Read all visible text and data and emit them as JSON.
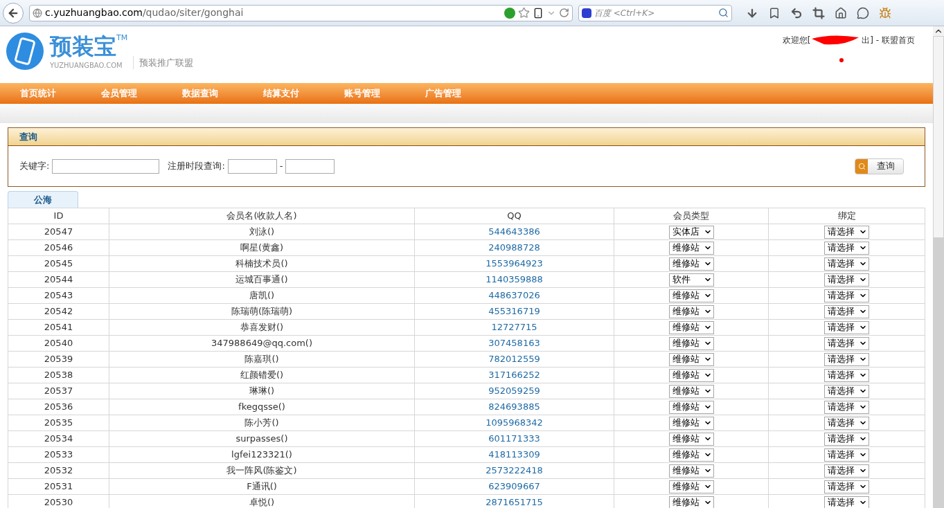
{
  "browser": {
    "url_host": "c.yuzhuangbao.com",
    "url_path": "/qudao/siter/gonghai",
    "search_placeholder": "百度 <Ctrl+K>"
  },
  "header": {
    "logo_name": "预装宝",
    "logo_tm": "TM",
    "logo_domain": "YUZHUANGBAO.COM",
    "subtitle": "预装推广联盟",
    "welcome_start": "欢迎您[",
    "welcome_end": "出] - 联盟首页"
  },
  "nav": [
    "首页统计",
    "会员管理",
    "数据查询",
    "结算支付",
    "账号管理",
    "广告管理"
  ],
  "query": {
    "title": "查询",
    "keyword_label": "关键字:",
    "period_label": "注册时段查询:",
    "separator": "-",
    "button": "查询"
  },
  "tabs": [
    {
      "label": "公海",
      "selected": true
    }
  ],
  "table": {
    "columns": [
      "ID",
      "会员名(收款人名)",
      "QQ",
      "会员类型",
      "绑定"
    ],
    "rows": [
      {
        "id": "20547",
        "name": "刘泳()",
        "qq": "544643386",
        "type": "实体店",
        "bind": "请选择"
      },
      {
        "id": "20546",
        "name": "啊星(黄鑫)",
        "qq": "240988728",
        "type": "维修站",
        "bind": "请选择"
      },
      {
        "id": "20545",
        "name": "科楠技术员()",
        "qq": "1553964923",
        "type": "维修站",
        "bind": "请选择"
      },
      {
        "id": "20544",
        "name": "运城百事通()",
        "qq": "1140359888",
        "type": "软件",
        "bind": "请选择"
      },
      {
        "id": "20543",
        "name": "唐凯()",
        "qq": "448637026",
        "type": "维修站",
        "bind": "请选择"
      },
      {
        "id": "20542",
        "name": "陈瑞萌(陈瑞萌)",
        "qq": "455316719",
        "type": "维修站",
        "bind": "请选择"
      },
      {
        "id": "20541",
        "name": "恭喜发财()",
        "qq": "12727715",
        "type": "维修站",
        "bind": "请选择"
      },
      {
        "id": "20540",
        "name": "347988649@qq.com()",
        "qq": "307458163",
        "type": "维修站",
        "bind": "请选择"
      },
      {
        "id": "20539",
        "name": "陈嘉琪()",
        "qq": "782012559",
        "type": "维修站",
        "bind": "请选择"
      },
      {
        "id": "20538",
        "name": "红颜错爱()",
        "qq": "317166252",
        "type": "维修站",
        "bind": "请选择"
      },
      {
        "id": "20537",
        "name": "琳琳()",
        "qq": "952059259",
        "type": "维修站",
        "bind": "请选择"
      },
      {
        "id": "20536",
        "name": "fkegqsse()",
        "qq": "824693885",
        "type": "维修站",
        "bind": "请选择"
      },
      {
        "id": "20535",
        "name": "陈小芳()",
        "qq": "1095968342",
        "type": "维修站",
        "bind": "请选择"
      },
      {
        "id": "20534",
        "name": "surpasses()",
        "qq": "601171333",
        "type": "维修站",
        "bind": "请选择"
      },
      {
        "id": "20533",
        "name": "lgfei123321()",
        "qq": "418113309",
        "type": "维修站",
        "bind": "请选择"
      },
      {
        "id": "20532",
        "name": "我一阵风(陈鉴文)",
        "qq": "2573222418",
        "type": "维修站",
        "bind": "请选择"
      },
      {
        "id": "20531",
        "name": "F通讯()",
        "qq": "623909667",
        "type": "维修站",
        "bind": "请选择"
      },
      {
        "id": "20530",
        "name": "卓悦()",
        "qq": "2871651715",
        "type": "维修站",
        "bind": "请选择"
      }
    ]
  }
}
